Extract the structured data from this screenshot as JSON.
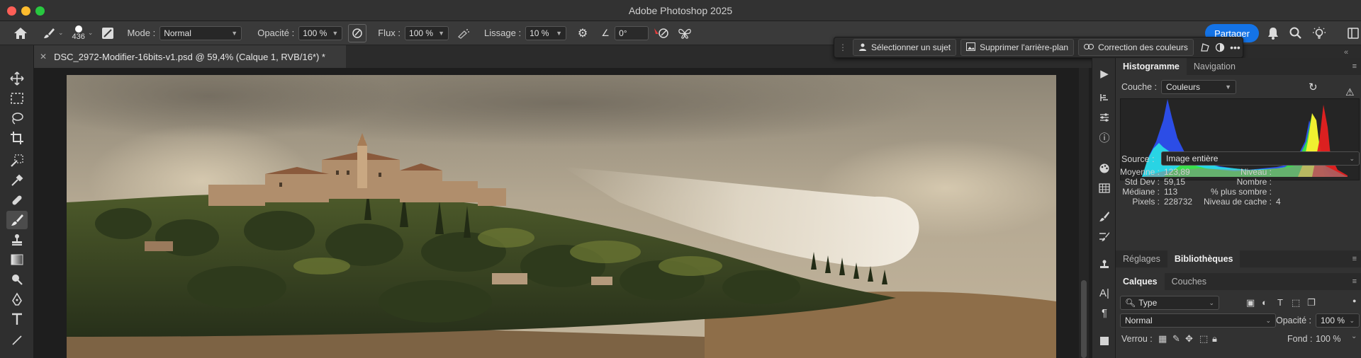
{
  "window": {
    "title": "Adobe Photoshop 2025"
  },
  "options_bar": {
    "brush_size": "436",
    "mode_label": "Mode :",
    "mode_value": "Normal",
    "opacity_label": "Opacité :",
    "opacity_value": "100 %",
    "flow_label": "Flux :",
    "flow_value": "100 %",
    "smoothing_label": "Lissage :",
    "smoothing_value": "10 %",
    "angle_value": "0°",
    "share_label": "Partager"
  },
  "document_tab": {
    "title": "DSC_2972-Modifier-16bits-v1.psd @ 59,4% (Calque 1, RVB/16*) *"
  },
  "context_bar": {
    "select_subject": "Sélectionner un sujet",
    "remove_background": "Supprimer l'arrière-plan",
    "color_correction": "Correction des couleurs"
  },
  "histogram_panel": {
    "tabs": [
      "Histogramme",
      "Navigation"
    ],
    "channel_label": "Couche :",
    "channel_value": "Couleurs",
    "source_label": "Source :",
    "source_value": "Image entière",
    "stats": {
      "mean_label": "Moyenne :",
      "mean_value": "123,89",
      "std_label": "Std Dev :",
      "std_value": "59,15",
      "median_label": "Médiane :",
      "median_value": "113",
      "pixels_label": "Pixels :",
      "pixels_value": "228732",
      "level_label": "Niveau :",
      "level_value": "",
      "count_label": "Nombre :",
      "count_value": "",
      "percentile_label": "% plus sombre :",
      "percentile_value": "",
      "cache_label": "Niveau de cache :",
      "cache_value": "4"
    }
  },
  "adjust_panel": {
    "tabs": [
      "Réglages",
      "Bibliothèques"
    ]
  },
  "layers_panel": {
    "tabs": [
      "Calques",
      "Couches"
    ],
    "filter_value": "Type",
    "blend_value": "Normal",
    "opacity_label": "Opacité :",
    "opacity_value": "100 %",
    "lock_label": "Verrou :",
    "fill_label": "Fond :",
    "fill_value": "100 %"
  },
  "colors": {
    "accent": "#1473e6",
    "panel_bg": "#323232",
    "toolbar_bg": "#2f2f2f"
  }
}
